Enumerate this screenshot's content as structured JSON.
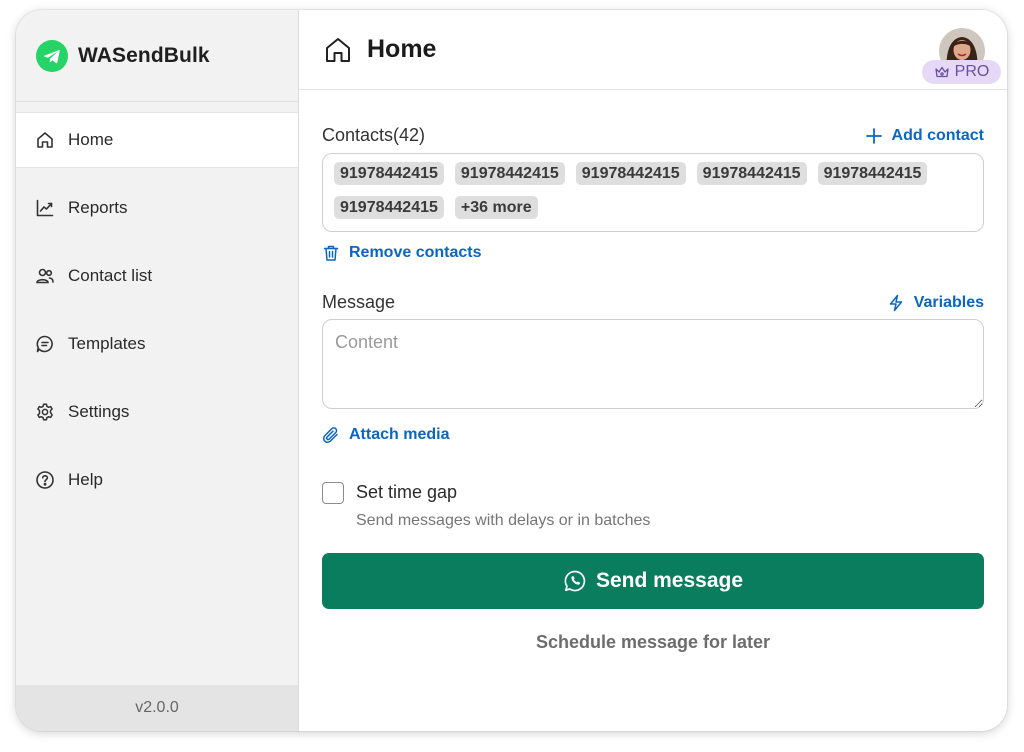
{
  "app": {
    "name": "WASendBulk",
    "version": "v2.0.0"
  },
  "sidebar": {
    "items": [
      {
        "label": "Home",
        "icon": "home-icon",
        "active": true
      },
      {
        "label": "Reports",
        "icon": "chart-icon",
        "active": false
      },
      {
        "label": "Contact list",
        "icon": "users-icon",
        "active": false
      },
      {
        "label": "Templates",
        "icon": "message-icon",
        "active": false
      },
      {
        "label": "Settings",
        "icon": "gear-icon",
        "active": false
      },
      {
        "label": "Help",
        "icon": "help-icon",
        "active": false
      }
    ]
  },
  "header": {
    "title": "Home",
    "badge": "PRO"
  },
  "contacts": {
    "label": "Contacts(42)",
    "add_label": "Add contact",
    "chips": [
      "91978442415",
      "91978442415",
      "91978442415",
      "91978442415",
      "91978442415",
      "91978442415"
    ],
    "more_label": "+36 more",
    "remove_label": "Remove contacts"
  },
  "message": {
    "label": "Message",
    "variables_label": "Variables",
    "placeholder": "Content",
    "value": "",
    "attach_label": "Attach media"
  },
  "time_gap": {
    "label": "Set time gap",
    "hint": "Send messages with delays or in batches",
    "checked": false
  },
  "actions": {
    "send_label": "Send message",
    "schedule_label": "Schedule message for later"
  },
  "colors": {
    "accent": "#0a66c2",
    "primary_button": "#0b7d5f",
    "brand_green": "#25d366",
    "pro_badge_bg": "#e5d9f7"
  }
}
